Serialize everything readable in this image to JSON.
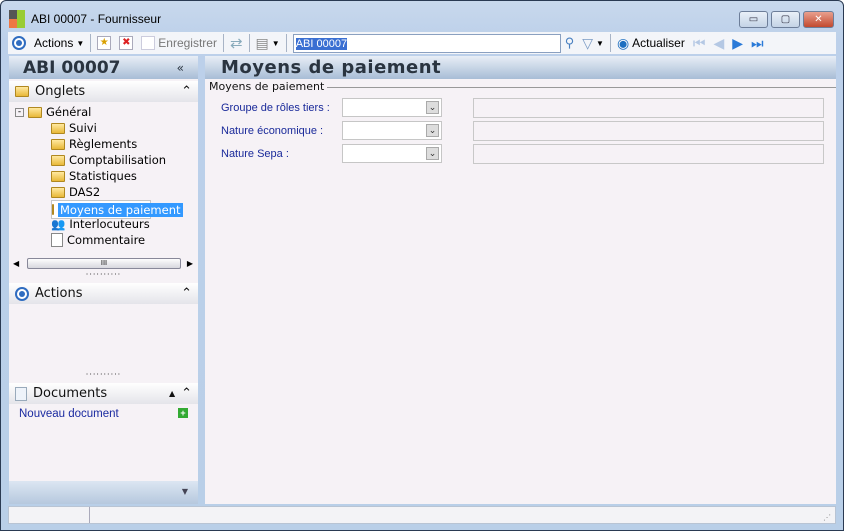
{
  "window": {
    "title": "ABI 00007 -  Fournisseur",
    "minimize": "▭",
    "maximize": "▢",
    "close": "✕"
  },
  "toolbar": {
    "actions": "Actions",
    "save": "Enregistrer",
    "search_value": "ABI 00007",
    "refresh": "Actualiser"
  },
  "left": {
    "header": "ABI 00007",
    "collapse": "«",
    "onglets": {
      "title": "Onglets",
      "items": [
        "Général",
        "Suivi",
        "Règlements",
        "Comptabilisation",
        "Statistiques",
        "DAS2",
        "Moyens de paiement",
        "Interlocuteurs",
        "Commentaire"
      ]
    },
    "actions": {
      "title": "Actions"
    },
    "documents": {
      "title": "Documents",
      "new": "Nouveau document"
    },
    "scroll_grip": "III"
  },
  "main": {
    "title": "Moyens de paiement",
    "group": "Moyens de paiement",
    "fields": [
      {
        "label": "Groupe de rôles tiers :",
        "value": ""
      },
      {
        "label": "Nature économique :",
        "value": ""
      },
      {
        "label": "Nature Sepa :",
        "value": ""
      }
    ]
  }
}
